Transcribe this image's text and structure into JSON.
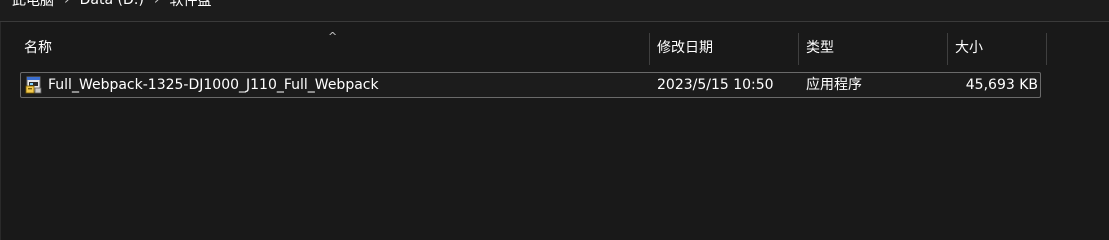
{
  "breadcrumb": {
    "items": [
      "此电脑",
      "Data (D:)",
      "软件盘"
    ]
  },
  "columns": {
    "name": "名称",
    "modified": "修改日期",
    "type": "类型",
    "size": "大小"
  },
  "sort": {
    "column": "name",
    "indicator": "^"
  },
  "files": [
    {
      "name": "Full_Webpack-1325-DJ1000_J110_Full_Webpack",
      "modified": "2023/5/15 10:50",
      "type": "应用程序",
      "size": "45,693 KB",
      "icon": "installer-app-icon"
    }
  ],
  "colors": {
    "background": "#191919",
    "text": "#ffffff",
    "row_border": "#6a6a6a",
    "divider": "#3f3f3f"
  }
}
